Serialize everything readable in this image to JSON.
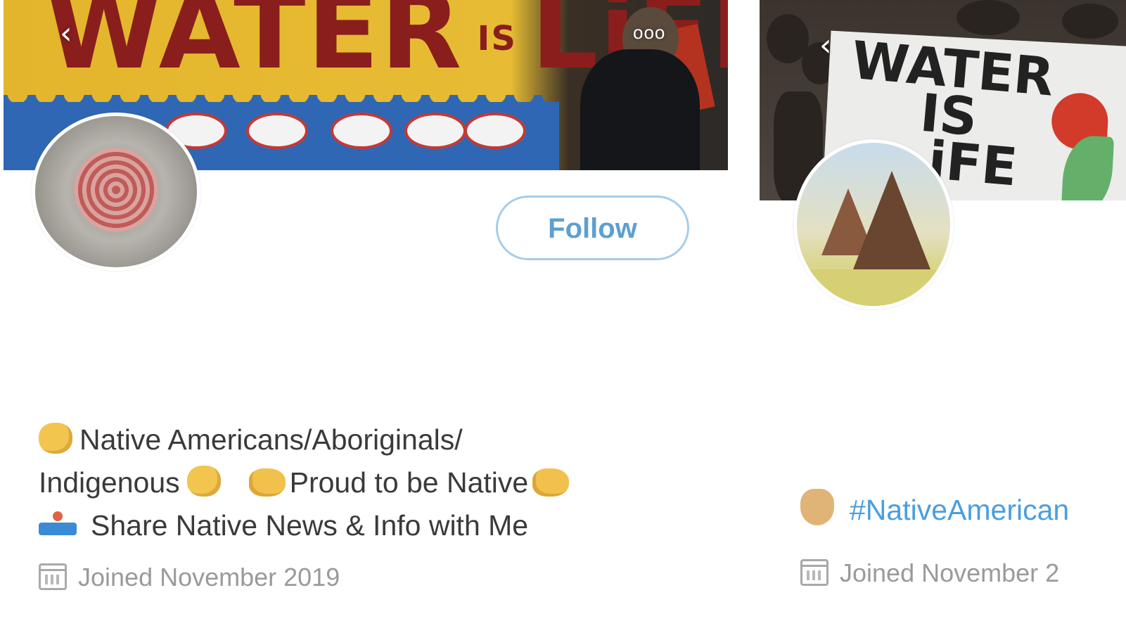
{
  "profile_left": {
    "banner": {
      "sign_word_1": "WATER",
      "sign_word_2": "IS",
      "sign_word_3": "LiFE"
    },
    "back_icon": "‹",
    "more_icon": "ooo",
    "follow_label": "Follow",
    "bio": {
      "line1": "Native Americans/Aboriginals/",
      "line2a": "Indigenous",
      "line2b": "Proud to be Native",
      "line3": "Share Native News & Info with Me"
    },
    "joined": "Joined November 2019"
  },
  "profile_right": {
    "banner": {
      "sign_line1": "WATER",
      "sign_line2": "IS",
      "sign_line3": "iFE"
    },
    "back_icon": "‹",
    "bio_hashtag": "#NativeAmerican",
    "joined": "Joined November 2"
  },
  "colors": {
    "follow_border": "#a7cde8",
    "follow_text": "#5e9fd0",
    "hashtag": "#4a9ee0",
    "banner_yellow": "#e3b52c",
    "banner_red_text": "#8a1e1c",
    "joined_text": "#9a9a9a"
  }
}
